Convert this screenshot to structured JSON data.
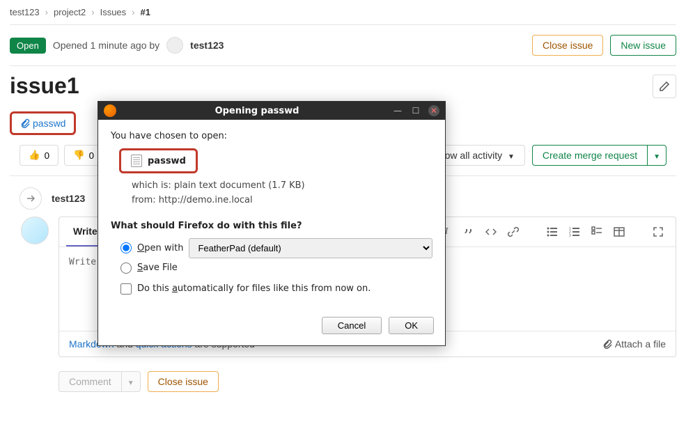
{
  "breadcrumb": {
    "items": [
      "test123",
      "project2",
      "Issues"
    ],
    "current": "#1"
  },
  "status": {
    "badge": "Open",
    "opened_prefix": "Opened",
    "opened_time": "1 minute ago",
    "by": "by",
    "author": "test123"
  },
  "header_actions": {
    "close": "Close issue",
    "new": "New issue"
  },
  "issue": {
    "title": "issue1",
    "attachment_name": "passwd"
  },
  "reactions": {
    "thumbs_up": "0",
    "thumbs_down": "0"
  },
  "activity": {
    "filter": "Show all activity",
    "merge": "Create merge request",
    "user": "test123"
  },
  "comment": {
    "tab_write": "Write",
    "placeholder": "Write",
    "markdown": "Markdown",
    "and": " and ",
    "quick": "quick actions",
    "supported": " are supported",
    "attach": "Attach a file",
    "btn_comment": "Comment",
    "btn_close": "Close issue"
  },
  "modal": {
    "title": "Opening passwd",
    "chosen": "You have chosen to open:",
    "filename": "passwd",
    "which_is": "which is: plain text document (1.7 KB)",
    "from": "from: http://demo.ine.local",
    "question": "What should Firefox do with this file?",
    "open_with": "Open with",
    "app": "FeatherPad (default)",
    "save": "Save File",
    "auto_pre": "Do this ",
    "auto_key": "a",
    "auto_post": "utomatically for files like this from now on.",
    "cancel": "Cancel",
    "ok": "OK",
    "open_key_pre": "",
    "open_key": "O",
    "open_key_post": "pen with",
    "save_key": "S",
    "save_post": "ave File"
  }
}
